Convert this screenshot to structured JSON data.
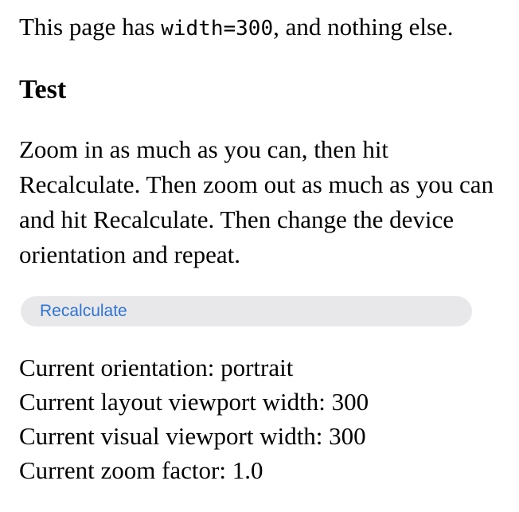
{
  "intro": {
    "before": "This page has ",
    "code": "width=300",
    "after": ", and nothing else."
  },
  "test_heading": "Test",
  "instructions": "Zoom in as much as you can, then hit Recalculate. Then zoom out as much as you can and hit Recalculate. Then change the device orientation and repeat.",
  "recalculate_button": "Recalculate",
  "results": [
    "Current orientation: portrait",
    "Current layout viewport width: 300",
    "Current visual viewport width: 300",
    "Current zoom factor: 1.0"
  ],
  "colors": {
    "button_background": "#e8e8ea",
    "button_text": "#2f74d0"
  }
}
